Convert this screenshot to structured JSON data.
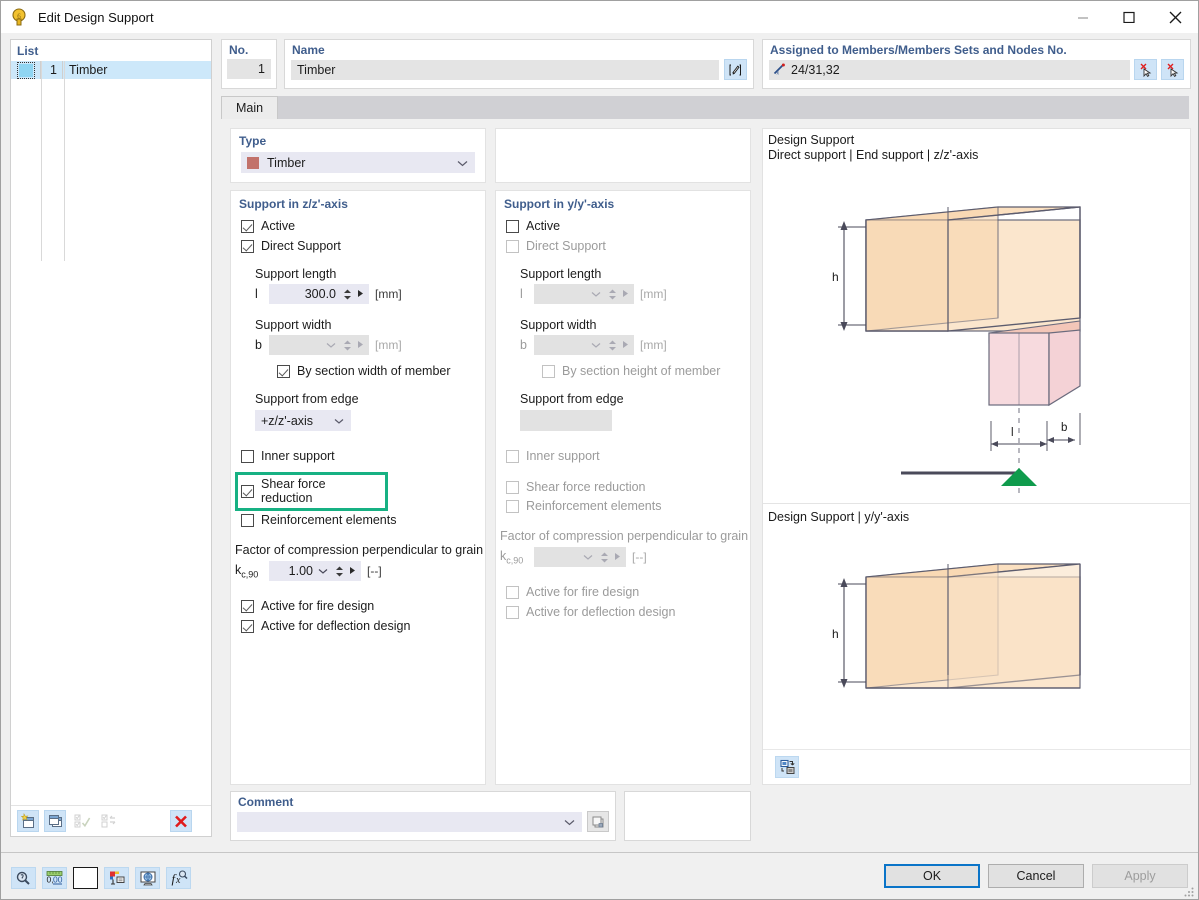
{
  "window": {
    "title": "Edit Design Support",
    "icon": "design-support-icon",
    "minimize": "–",
    "maximize": "□",
    "close": "✕"
  },
  "list": {
    "header": "List",
    "rows": [
      {
        "no": "1",
        "name": "Timber",
        "color": "#8fd5f2"
      }
    ],
    "toolbar": [
      {
        "name": "new-item-button",
        "glyph": "new"
      },
      {
        "name": "copy-item-button",
        "glyph": "copy"
      },
      {
        "name": "select-all-button",
        "glyph": "check-all"
      },
      {
        "name": "invert-selection-button",
        "glyph": "invert"
      },
      {
        "name": "delete-item-button",
        "glyph": "delete"
      }
    ]
  },
  "header": {
    "no_label": "No.",
    "no_value": "1",
    "name_label": "Name",
    "name_value": "Timber",
    "name_edit_icon": "edit-pencil-icon",
    "assigned_label": "Assigned to Members/Members Sets and Nodes No.",
    "assigned_value": "24/31,32",
    "assigned_icon": "member-icon",
    "pick1_icon": "pick-members-icon",
    "pick2_icon": "pick-nodes-icon"
  },
  "tabs": [
    {
      "label": "Main",
      "active": true
    }
  ],
  "type_section": {
    "title": "Type",
    "value": "Timber",
    "swatch": "#c2726b"
  },
  "support_z": {
    "title": "Support in z/z'-axis",
    "active": {
      "label": "Active",
      "checked": true,
      "enabled": true
    },
    "direct_support": {
      "label": "Direct Support",
      "checked": true,
      "enabled": true
    },
    "support_length": {
      "label": "Support length",
      "symbol": "l",
      "value": "300.0",
      "unit": "[mm]",
      "enabled": true
    },
    "support_width": {
      "label": "Support width",
      "symbol": "b",
      "value": "",
      "unit": "[mm]",
      "enabled": false
    },
    "by_section_width": {
      "label": "By section width of member",
      "checked": true,
      "enabled": true
    },
    "support_from_edge": {
      "label": "Support from edge",
      "value": "+z/z'-axis",
      "enabled": true
    },
    "inner_support": {
      "label": "Inner support",
      "checked": false,
      "enabled": true
    },
    "shear_force_reduction": {
      "label": "Shear force reduction",
      "checked": true,
      "enabled": true,
      "highlighted": true
    },
    "reinforcement_elements": {
      "label": "Reinforcement elements",
      "checked": false,
      "enabled": true
    },
    "kc90": {
      "label": "Factor of compression perpendicular to grain",
      "symbol": "k",
      "sub": "c,90",
      "value": "1.00",
      "unit": "[--]",
      "enabled": true
    },
    "active_fire": {
      "label": "Active for fire design",
      "checked": true,
      "enabled": true
    },
    "active_deflection": {
      "label": "Active for deflection design",
      "checked": true,
      "enabled": true
    }
  },
  "support_y": {
    "title": "Support in y/y'-axis",
    "active": {
      "label": "Active",
      "checked": false,
      "enabled": true
    },
    "direct_support": {
      "label": "Direct Support",
      "checked": false,
      "enabled": false
    },
    "support_length": {
      "label": "Support length",
      "symbol": "l",
      "value": "",
      "unit": "[mm]",
      "enabled": false
    },
    "support_width": {
      "label": "Support width",
      "symbol": "b",
      "value": "",
      "unit": "[mm]",
      "enabled": false
    },
    "by_section_height": {
      "label": "By section height of member",
      "checked": false,
      "enabled": false
    },
    "support_from_edge": {
      "label": "Support from edge",
      "value": "",
      "enabled": false
    },
    "inner_support": {
      "label": "Inner support",
      "checked": false,
      "enabled": false
    },
    "shear_force_reduction": {
      "label": "Shear force reduction",
      "checked": false,
      "enabled": false
    },
    "reinforcement_elements": {
      "label": "Reinforcement elements",
      "checked": false,
      "enabled": false
    },
    "kc90": {
      "label": "Factor of compression perpendicular to grain",
      "symbol": "k",
      "sub": "c,90",
      "value": "",
      "unit": "[--]",
      "enabled": false
    },
    "active_fire": {
      "label": "Active for fire design",
      "checked": false,
      "enabled": false
    },
    "active_deflection": {
      "label": "Active for deflection design",
      "checked": false,
      "enabled": false
    }
  },
  "preview": {
    "top_title_line1": "Design Support",
    "top_title_line2": "Direct support | End support | z/z'-axis",
    "bottom_title": "Design Support | y/y'-axis",
    "dim_h": "h",
    "dim_l": "l",
    "dim_b": "b",
    "dim_h2": "h",
    "beam_fill": "#fbe0c0",
    "beam_stroke": "#5c5c6e",
    "support_fill": "#f7dade",
    "support_stroke": "#6b6b7d",
    "node_color": "#0f9b4c",
    "toolbar_icon": "export-image-icon"
  },
  "comment": {
    "label": "Comment",
    "value": "",
    "copy_icon": "copy-comment-icon"
  },
  "bottom_toolbar": [
    {
      "name": "units-magnifier-button",
      "glyph": "magnifier"
    },
    {
      "name": "decimal-places-button",
      "glyph": "0,00"
    },
    {
      "name": "color-button",
      "glyph": "white-square"
    },
    {
      "name": "graphic-settings-button",
      "glyph": "graphic"
    },
    {
      "name": "visibility-button",
      "glyph": "globe"
    },
    {
      "name": "formula-button",
      "glyph": "fx"
    }
  ],
  "buttons": {
    "ok": "OK",
    "cancel": "Cancel",
    "apply": "Apply"
  }
}
